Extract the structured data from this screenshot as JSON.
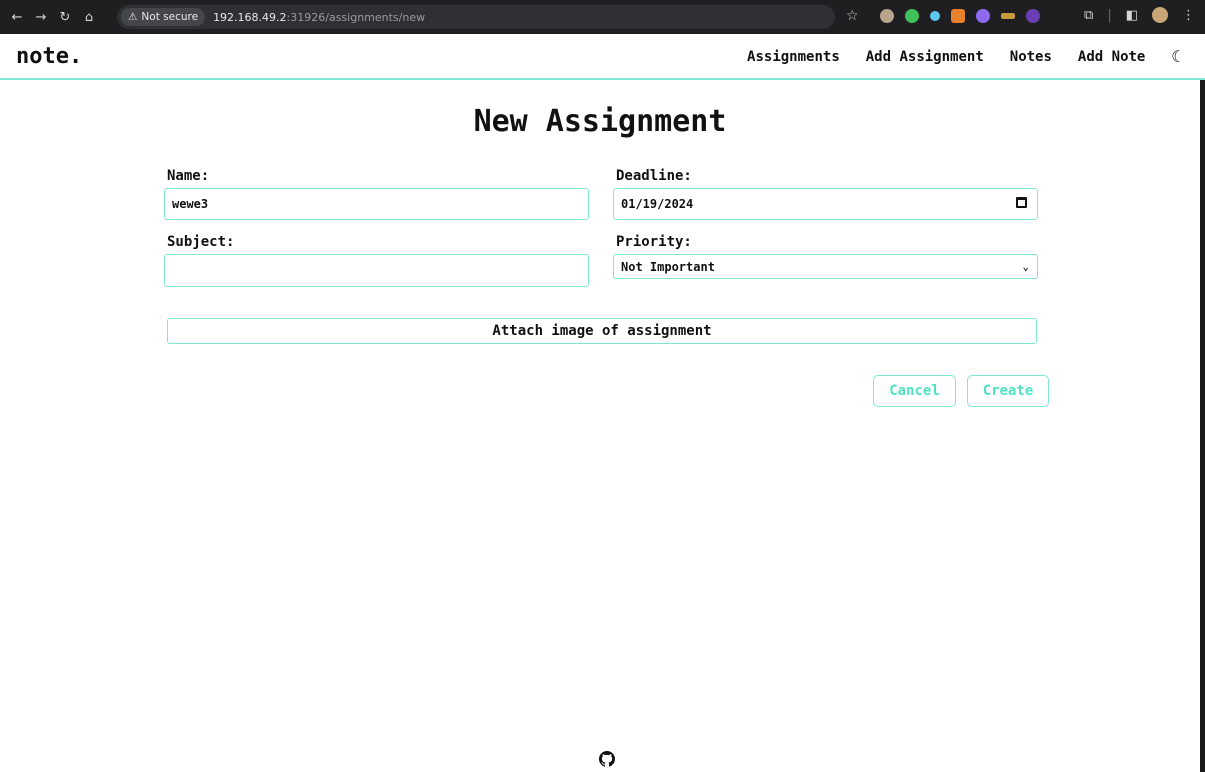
{
  "browser": {
    "security_label": "Not secure",
    "url_host": "192.168.49.2",
    "url_path": ":31926/assignments/new"
  },
  "app": {
    "brand": "note.",
    "nav": [
      "Assignments",
      "Add Assignment",
      "Notes",
      "Add Note"
    ],
    "theme_icon": "moon-icon"
  },
  "form": {
    "title": "New Assignment",
    "name_label": "Name:",
    "name_value": "wewe3",
    "deadline_label": "Deadline:",
    "deadline_value": "01/19/2024",
    "subject_label": "Subject:",
    "subject_value": "",
    "priority_label": "Priority:",
    "priority_value": "Not Important",
    "attach_label": "Attach image of assignment",
    "cancel_label": "Cancel",
    "create_label": "Create"
  },
  "colors": {
    "accent": "#7ee8d2",
    "button_text": "#4fe3c4"
  },
  "footer": {
    "icon": "github-icon"
  }
}
